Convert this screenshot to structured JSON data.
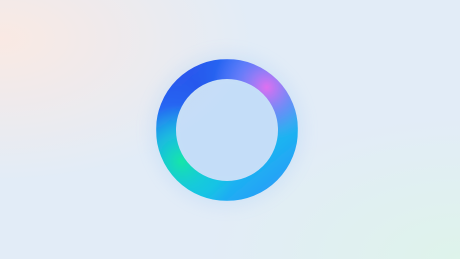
{
  "colors": {
    "background": "#e2ecf7",
    "ring_blue": "#1f8bff",
    "ring_deep_blue": "#2a5cf0",
    "ring_cyan": "#18d8d0",
    "ring_teal": "#12e6a8",
    "ring_magenta": "#e070f0",
    "ring_violet": "#9c7cf8",
    "corner_warm": "#fbe9e2",
    "corner_mint": "#def4ea"
  },
  "icons": {
    "center_graphic": "gradient-ring-icon"
  }
}
